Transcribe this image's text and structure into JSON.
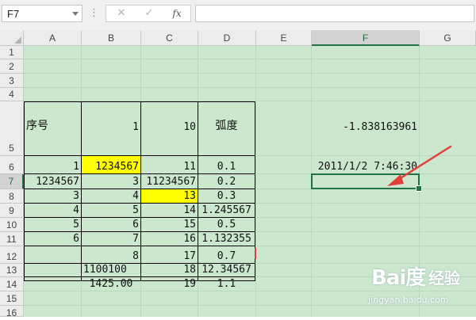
{
  "formula_bar": {
    "name_box": "F7",
    "more_icon": "ellipsis-vertical",
    "cancel_icon": "cross",
    "enter_icon": "check",
    "fx_label": "fx",
    "formula_value": ""
  },
  "columns": [
    "A",
    "B",
    "C",
    "D",
    "E",
    "F",
    "G"
  ],
  "rows": [
    "1",
    "2",
    "3",
    "4",
    "5",
    "6",
    "7",
    "8",
    "9",
    "10",
    "11",
    "12",
    "13",
    "14",
    "15",
    "16"
  ],
  "selected_cell": "F7",
  "cells": {
    "A5": "序号",
    "B5": "1",
    "C5": "10",
    "D5": "弧度",
    "F5": "-1.838163961",
    "A6": "1",
    "B6": "1234567",
    "C6": "11",
    "D6": "0.1",
    "F6": "2011/1/2 7:46:30",
    "A7": "1234567",
    "B7": "3",
    "C7": "11234567",
    "D7": "0.2",
    "A8": "3",
    "B8": "4",
    "C8": "13",
    "D8": "0.3",
    "A9": "4",
    "B9": "5",
    "C9": "14",
    "D9": "1.245567",
    "A10": "5",
    "B10": "6",
    "C10": "15",
    "D10": "0.5",
    "A11": "6",
    "B11": "7",
    "C11": "16",
    "D11": "1.132355",
    "B12": "8",
    "C12": "17",
    "D12": "0.7",
    "B13": "1100100",
    "C13": "18",
    "D13": "12.34567",
    "B14": "1425.00",
    "C14": "19",
    "D14": "1.1"
  },
  "highlight_color": "#ffff00",
  "sheet_color": "#cbe8cf",
  "accent_color": "#217346",
  "arrow_color": "#e0403a",
  "watermark": {
    "logo": "Bai度",
    "label": "经验",
    "url": "jingyan.baidu.com"
  }
}
